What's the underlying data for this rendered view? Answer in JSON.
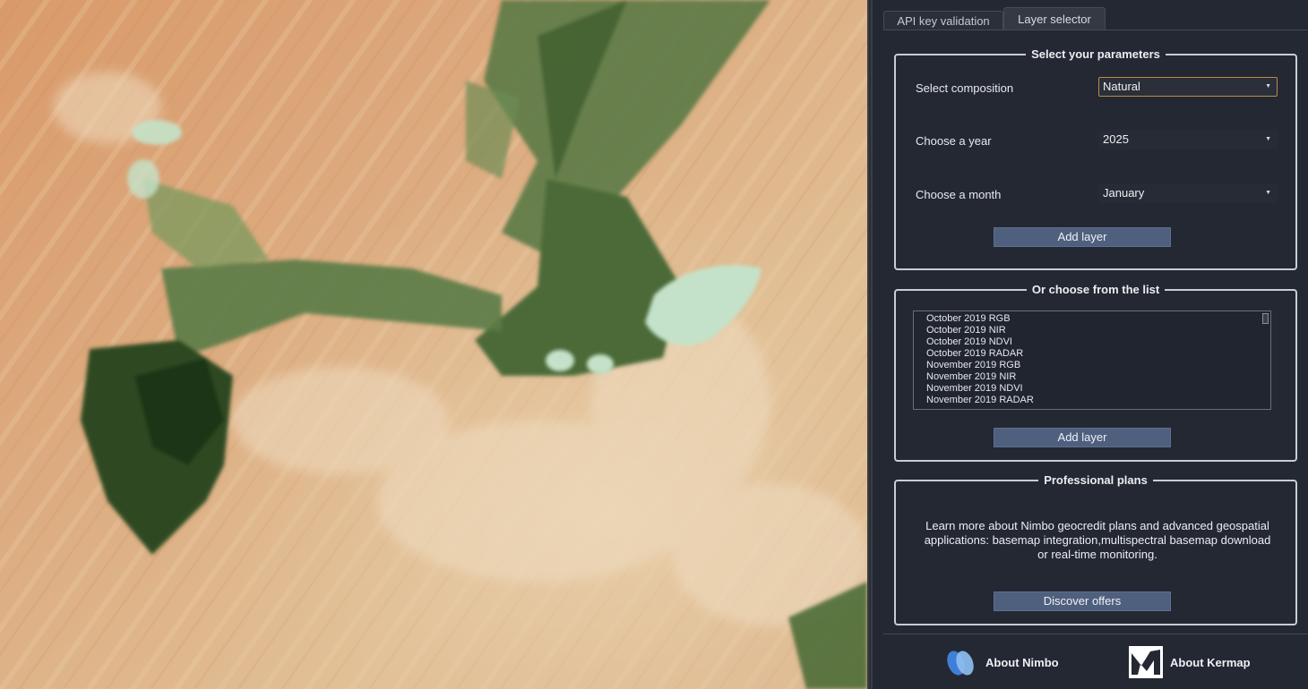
{
  "tabs": [
    {
      "label": "API key validation",
      "active": false
    },
    {
      "label": "Layer selector",
      "active": true
    }
  ],
  "params_group": {
    "title": "Select your parameters",
    "composition": {
      "label": "Select composition",
      "value": "Natural"
    },
    "year": {
      "label": "Choose a year",
      "value": "2025"
    },
    "month": {
      "label": "Choose a month",
      "value": "January"
    },
    "add_button": "Add layer"
  },
  "list_group": {
    "title": "Or choose from the list",
    "items": [
      "October 2019 RGB",
      "October 2019 NIR",
      "October 2019 NDVI",
      "October 2019 RADAR",
      "November 2019 RGB",
      "November 2019 NIR",
      "November 2019 NDVI",
      "November 2019 RADAR"
    ],
    "add_button": "Add layer"
  },
  "plans_group": {
    "title": "Professional plans",
    "text": "Learn more about Nimbo geocredit plans and advanced geospatial applications: basemap integration,multispectral basemap download or real-time monitoring.",
    "button": "Discover offers"
  },
  "footer": {
    "about_nimbo": "About Nimbo",
    "about_kermap": "About Kermap"
  },
  "colors": {
    "panel_bg": "#232833",
    "button_bg": "#4f5f7e",
    "focus_border": "#b98b4a",
    "desert": "#d9a878",
    "vegetation": "#4a6e35",
    "water": "#c4e2c9"
  },
  "icons": {
    "nimbo": "nimbo-logo-icon",
    "kermap": "kermap-logo-icon",
    "dropdown": "chevron-down-icon"
  }
}
